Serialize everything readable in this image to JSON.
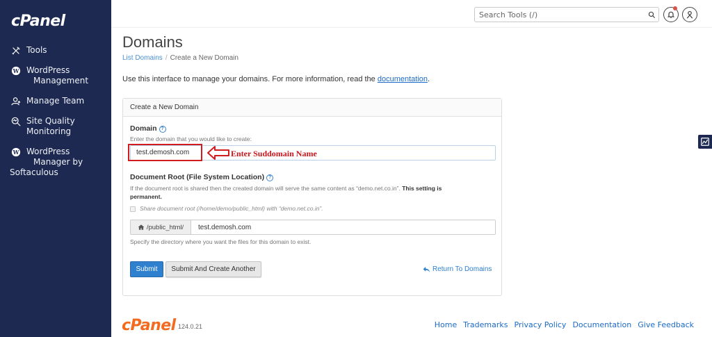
{
  "app": {
    "logo": "cPanel",
    "version": "124.0.21"
  },
  "sidebar": {
    "items": [
      {
        "icon": "tools-icon",
        "label_line1": "Tools",
        "label_line2": ""
      },
      {
        "icon": "wordpress-icon",
        "label_line1": "WordPress",
        "label_line2": "Management"
      },
      {
        "icon": "team-icon",
        "label_line1": "Manage Team",
        "label_line2": ""
      },
      {
        "icon": "search-monitor-icon",
        "label_line1": "Site Quality",
        "label_line2": "Monitoring"
      },
      {
        "icon": "wordpress-icon",
        "label_line1": "WordPress",
        "label_line2": "Manager by",
        "label_line3": "Softaculous"
      }
    ]
  },
  "topbar": {
    "search_placeholder": "Search Tools (/)"
  },
  "page": {
    "title": "Domains",
    "breadcrumb": {
      "link": "List Domains",
      "separator": "/",
      "current": "Create a New Domain"
    },
    "intro_text": "Use this interface to manage your domains. For more information, read the ",
    "intro_link": "documentation",
    "intro_end": "."
  },
  "form": {
    "panel_title": "Create a New Domain",
    "domain_label": "Domain",
    "domain_hint": "Enter the domain that you would like to create:",
    "domain_value": "test.demosh.com",
    "annotation": "Enter Suddomain Name",
    "docroot_label": "Document Root (File System Location)",
    "docroot_hint": "If the document root is shared then the created domain will serve the same content as “demo.net.co.in”. ",
    "docroot_hint_bold": "This setting is",
    "docroot_hint_bold2": "permanent.",
    "share_label": "Share document root (/home/demo/public_html) with “demo.net.co.in”.",
    "docroot_prefix": "/public_html/",
    "docroot_value": "test.demosh.com",
    "docroot_help": "Specify the directory where you want the files for this domain to exist.",
    "submit_label": "Submit",
    "submit_another_label": "Submit And Create Another",
    "return_label": "Return To Domains"
  },
  "footer": {
    "links": [
      "Home",
      "Trademarks",
      "Privacy Policy",
      "Documentation",
      "Give Feedback"
    ]
  },
  "colors": {
    "sidebar": "#1d2951",
    "accent": "#2f80cf",
    "annotation": "#d01c1c",
    "brand_orange": "#f36b21"
  }
}
